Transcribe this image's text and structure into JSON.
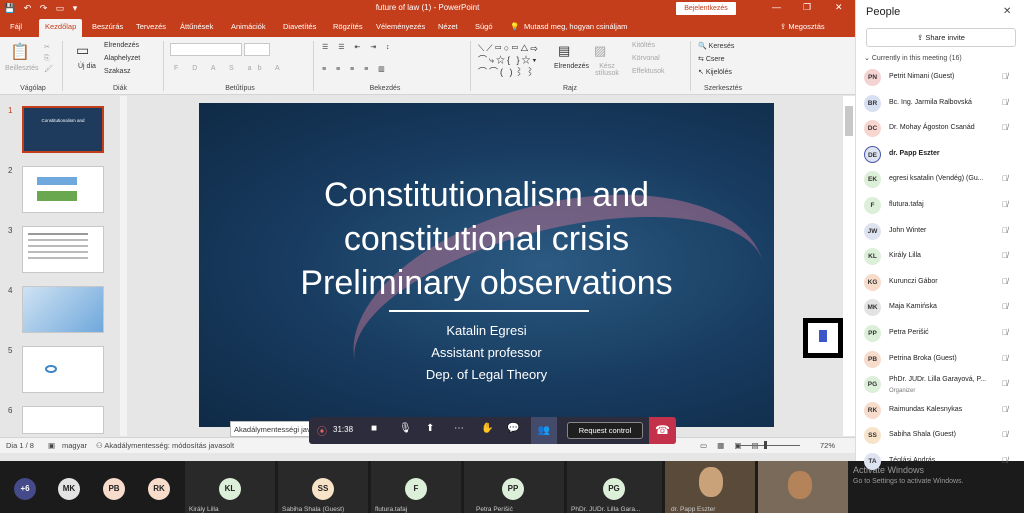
{
  "window": {
    "title": "future of law (1)  -  PowerPoint",
    "login_button": "Bejelentkezés",
    "share": "Megosztás"
  },
  "ribbon_tabs": [
    "Fájl",
    "Kezdőlap",
    "Beszúrás",
    "Tervezés",
    "Áttűnések",
    "Animációk",
    "Diavetítés",
    "Rögzítés",
    "Véleményezés",
    "Nézet",
    "Súgó",
    "Mutasd meg, hogyan csináljam"
  ],
  "ribbon": {
    "beillesztes": "Beillesztés",
    "uj_dia": "Új dia",
    "elrendezes": "Elrendezés",
    "alaphelyzet": "Alaphelyzet",
    "szakasz": "Szakasz",
    "elrendezes2": "Elrendezés",
    "kesz_stilusok": "Kész stílusok",
    "kitoltes": "Kitöltés",
    "korvonal": "Körvonal",
    "effektusok": "Effektusok",
    "kereses": "Keresés",
    "csere": "Csere",
    "kijeloles": "Kijelölés",
    "groups": {
      "vagolap": "Vágólap",
      "diak": "Diák",
      "betutipus": "Betűtípus",
      "bekezdes": "Bekezdés",
      "rajz": "Rajz",
      "szerkesztes": "Szerkesztés"
    }
  },
  "thumbnails": [
    "1",
    "2",
    "3",
    "4",
    "5",
    "6"
  ],
  "slide": {
    "title_lines": [
      "Constitutionalism and",
      "constitutional crisis",
      "Preliminary observations"
    ],
    "author": "Katalin Egresi",
    "role": "Assistant professor",
    "dept": "Dep. of Legal Theory"
  },
  "status": {
    "slide_count": "Dia 1 / 8",
    "language": "magyar",
    "accessibility": "Akadálymentesség: módosítás javasolt",
    "zoom": "72%"
  },
  "tooltip": "Akadálymentességi javaslat",
  "call": {
    "timer": "31:38",
    "request_control": "Request control"
  },
  "people": {
    "title": "People",
    "share_invite": "Share invite",
    "section": "Currently in this meeting (16)",
    "list": [
      {
        "initials": "PN",
        "name": "Petrit Nimani (Guest)",
        "color": "#f4d3d3"
      },
      {
        "initials": "BR",
        "name": "Bc. Ing. Jarmila Ralbovská",
        "color": "#d7e0f2"
      },
      {
        "initials": "DC",
        "name": "Dr. Mohay Ágoston Csanád",
        "color": "#f7d6cf"
      },
      {
        "initials": "DE",
        "name": "dr. Papp Eszter",
        "color": "#dde3f0"
      },
      {
        "initials": "EK",
        "name": "egresi ksatalin (Vendég) (Gu...",
        "color": "#dcefd8"
      },
      {
        "initials": "F",
        "name": "flutura.tafaj",
        "color": "#dcefd8"
      },
      {
        "initials": "JW",
        "name": "John Winter",
        "color": "#dde3f0"
      },
      {
        "initials": "KL",
        "name": "Király Lilla",
        "color": "#dcefd8"
      },
      {
        "initials": "KG",
        "name": "Kurunczi Gábor",
        "color": "#f7dccc"
      },
      {
        "initials": "MK",
        "name": "Maja Kamińska",
        "color": "#e3e3e3"
      },
      {
        "initials": "PP",
        "name": "Petra Perišić",
        "color": "#dcefd8"
      },
      {
        "initials": "PB",
        "name": "Petrina Broka (Guest)",
        "color": "#f7dccc"
      },
      {
        "initials": "PG",
        "name": "PhDr. JUDr. Lilla Garayová, P...",
        "sub": "Organizer",
        "color": "#dcefd8"
      },
      {
        "initials": "RK",
        "name": "Raimundas Kalesnykas",
        "color": "#f7dccc"
      },
      {
        "initials": "SS",
        "name": "Sabiha Shala (Guest)",
        "color": "#f7e3c8"
      },
      {
        "initials": "TA",
        "name": "Téglási András",
        "color": "#dde3f0"
      }
    ]
  },
  "gallery": {
    "overflow": "+6",
    "avatars": [
      {
        "initials": "MK",
        "color": "#e3e3e3"
      },
      {
        "initials": "PB",
        "color": "#f7dccc"
      },
      {
        "initials": "RK",
        "color": "#f7dccc"
      }
    ],
    "tiles": [
      {
        "initials": "KL",
        "name": "Király Lilla",
        "color": "#dcefd8"
      },
      {
        "initials": "SS",
        "name": "Sabiha Shala (Guest)",
        "color": "#f7e3c8"
      },
      {
        "initials": "F",
        "name": "flutura.tafaj",
        "color": "#dcefd8"
      },
      {
        "initials": "PP",
        "name": "Petra Perišić",
        "color": "#dcefd8"
      },
      {
        "initials": "PG",
        "name": "PhDr. JUDr. Lilla Gara...",
        "color": "#dcefd8"
      }
    ],
    "video_name": "dr. Papp Eszter"
  },
  "watermark": {
    "line1": "Activate Windows",
    "line2": "Go to Settings to activate Windows."
  }
}
